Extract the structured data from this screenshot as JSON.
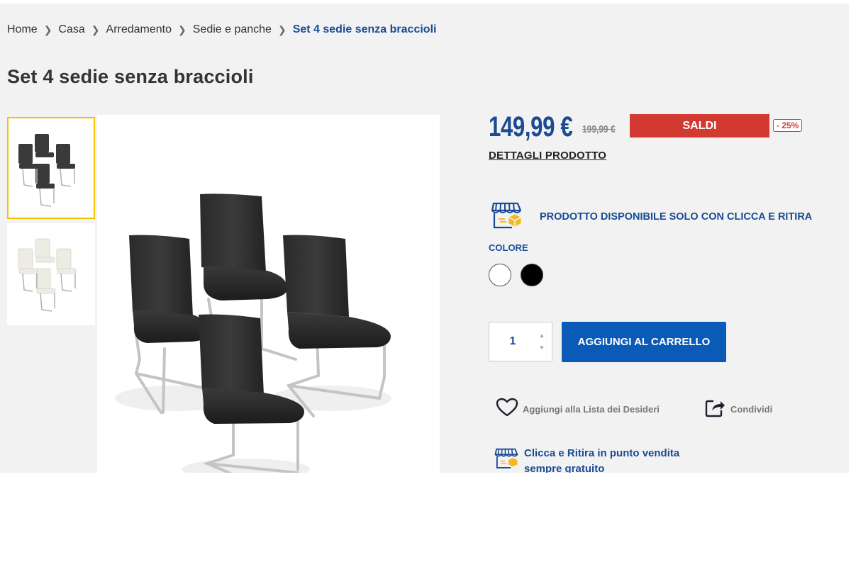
{
  "breadcrumb": {
    "items": [
      "Home",
      "Casa",
      "Arredamento",
      "Sedie e panche"
    ],
    "current": "Set 4 sedie senza braccioli"
  },
  "product": {
    "title": "Set 4 sedie senza braccioli",
    "price": "149,99 €",
    "old_price": "199,99 €",
    "sale_badge": "SALDI",
    "discount": "- 25%",
    "details_link": "DETTAGLI PRODOTTO",
    "availability_prefix": "PRODOTTO DISPONIBILE SOLO CON ",
    "availability_highlight": "CLICCA E RITIRA",
    "color_label": "COLORE",
    "colors": [
      {
        "name": "white",
        "hex": "#ffffff"
      },
      {
        "name": "black",
        "hex": "#000000"
      }
    ],
    "quantity": "1",
    "add_to_cart": "AGGIUNGI AL CARRELLO",
    "wishlist": "Aggiungi alla Lista dei Desideri",
    "share": "Condividi",
    "promo_line1": "Clicca e Ritira in punto vendita",
    "promo_line2": "sempre gratuito"
  },
  "icons": [
    "store-icon",
    "heart-icon",
    "share-icon",
    "chevron-right-icon"
  ],
  "colors": {
    "brand_blue": "#1a4b94",
    "button_blue": "#0a5bb8",
    "sale_red": "#d23a31",
    "thumb_selected": "#f2c200"
  }
}
